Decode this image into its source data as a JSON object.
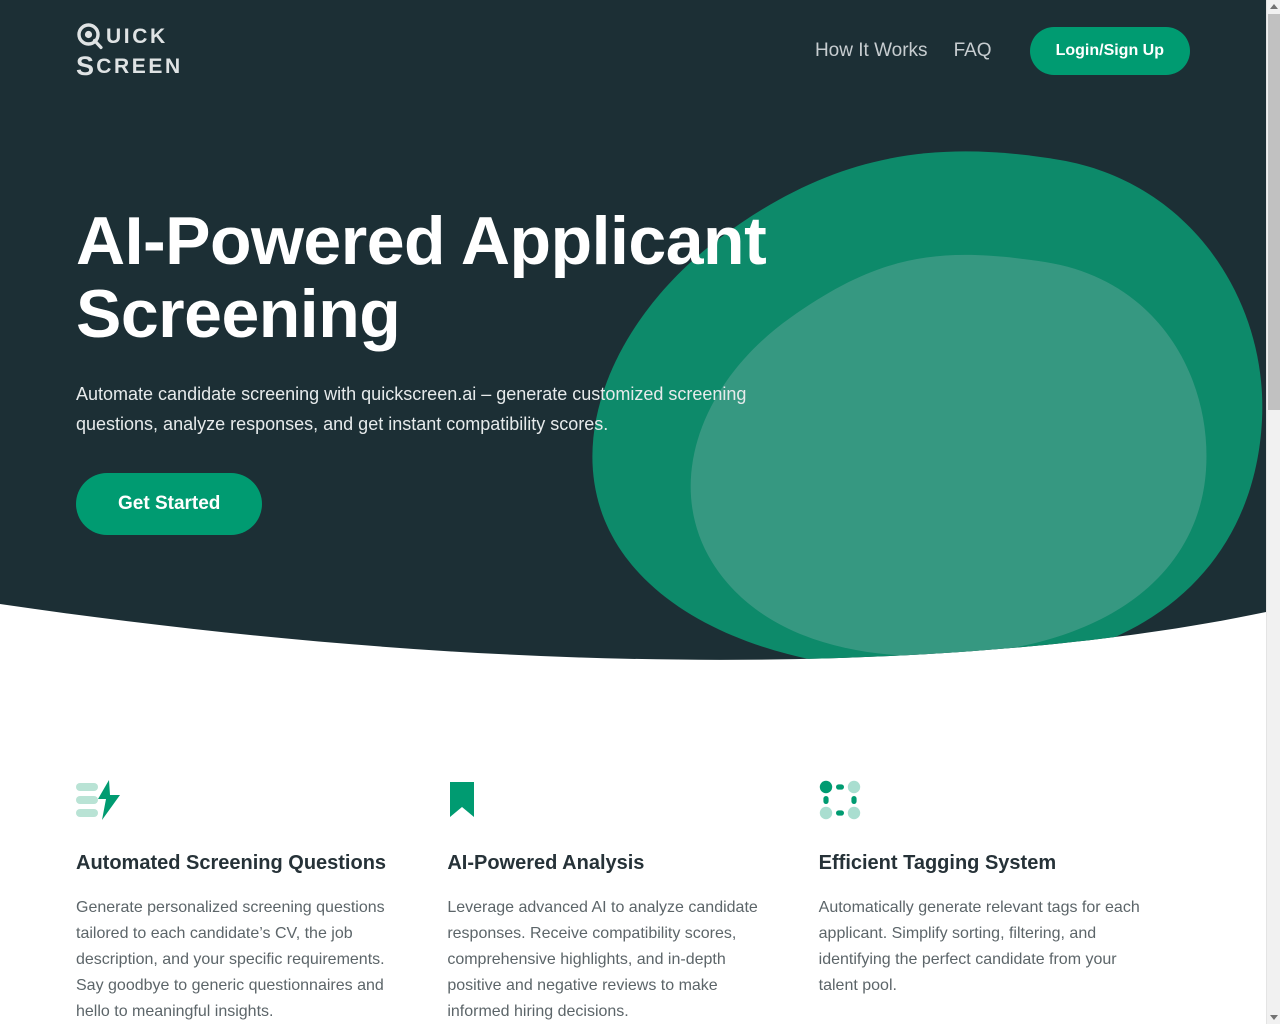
{
  "brand": {
    "logo_line1": "QUICK",
    "logo_line2": "SCREEN",
    "logo_q": "Q",
    "logo_rest1": "UICK",
    "logo_s": "S",
    "logo_rest2": "CREEN"
  },
  "colors": {
    "hero_background": "#1c2f35",
    "accent_green": "#009b71",
    "blob_dark": "#0d8a6a",
    "blob_light": "#2a8c78",
    "page_background": "#ffffff",
    "heading_text": "#263238",
    "body_text": "#5c6569",
    "nav_text": "#c7cdd0"
  },
  "nav": {
    "links": [
      {
        "label": "How It Works"
      },
      {
        "label": "FAQ"
      }
    ],
    "cta_label": "Login/Sign Up"
  },
  "hero": {
    "title": "AI-Powered Applicant Screening",
    "subtitle": "Automate candidate screening with quickscreen.ai – generate customized screening questions, analyze responses, and get instant compatibility scores.",
    "cta_label": "Get Started"
  },
  "features": [
    {
      "icon": "list-lightning-icon",
      "title": "Automated Screening Questions",
      "description": "Generate personalized screening questions tailored to each candidate’s CV, the job description, and your specific requirements. Say goodbye to generic questionnaires and hello to meaningful insights."
    },
    {
      "icon": "bookmark-icon",
      "title": "AI-Powered Analysis",
      "description": "Leverage advanced AI to analyze candidate responses. Receive compatibility scores, comprehensive highlights, and in-depth positive and negative reviews to make informed hiring decisions."
    },
    {
      "icon": "tag-grid-icon",
      "title": "Efficient Tagging System",
      "description": "Automatically generate relevant tags for each applicant. Simplify sorting, filtering, and identifying the perfect candidate from your talent pool."
    }
  ]
}
